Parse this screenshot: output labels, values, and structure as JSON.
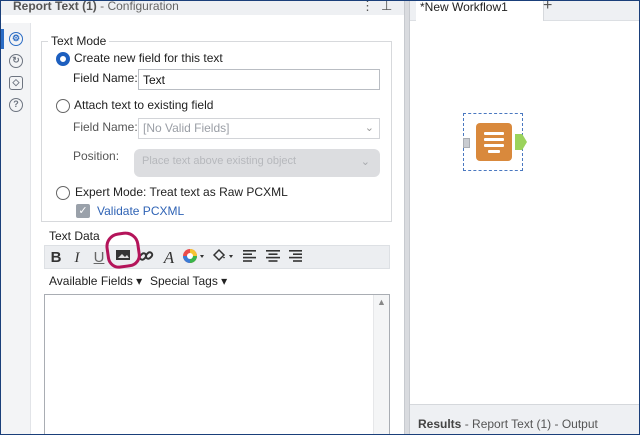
{
  "panel": {
    "title_tool": "Report Text (1)",
    "title_sep": " - ",
    "title_section": "Configuration",
    "menu_icon": "more-vertical-icon",
    "pin_icon": "pin-icon"
  },
  "side_rail": [
    {
      "icon": "gear-icon",
      "glyph": "⚙",
      "active": true
    },
    {
      "icon": "connections-icon",
      "glyph": "⟲",
      "active": false
    },
    {
      "icon": "tag-icon",
      "glyph": "◇",
      "active": false
    },
    {
      "icon": "help-icon",
      "glyph": "?",
      "active": false
    }
  ],
  "text_mode": {
    "legend": "Text Mode",
    "option_create": "Create new field for this text",
    "field_name_label": "Field Name:",
    "field_name_value": "Text",
    "option_attach": "Attach text to existing field",
    "attach_field_label": "Field Name:",
    "attach_field_value": "[No Valid Fields]",
    "position_label": "Position:",
    "position_value": "Place text above existing object",
    "option_expert": "Expert Mode: Treat text as Raw PCXML",
    "validate_label": "Validate PCXML",
    "selected_option": "create"
  },
  "text_data": {
    "legend": "Text Data",
    "toolbar": [
      {
        "name": "bold-button",
        "glyph": "B"
      },
      {
        "name": "italic-button",
        "glyph": "I"
      },
      {
        "name": "underline-button",
        "glyph": "U"
      },
      {
        "name": "insert-image-button",
        "glyph": "▬"
      },
      {
        "name": "insert-link-button",
        "glyph": "🔗"
      },
      {
        "name": "font-button",
        "glyph": "A"
      },
      {
        "name": "text-color-button",
        "glyph": "●"
      },
      {
        "name": "fill-color-button",
        "glyph": "◈"
      },
      {
        "name": "align-left-button",
        "glyph": "≡"
      },
      {
        "name": "align-center-button",
        "glyph": "≡"
      },
      {
        "name": "align-right-button",
        "glyph": "≡"
      }
    ],
    "available_fields_label": "Available Fields",
    "special_tags_label": "Special Tags",
    "dropdown_caret": "▾",
    "editor_value": ""
  },
  "canvas": {
    "tab_label": "*New Workflow1",
    "add_tab_glyph": "+",
    "tool_name": "report-text-tool"
  },
  "results": {
    "label": "Results",
    "sep": " - ",
    "detail": "Report Text (1) - Output"
  },
  "colors": {
    "accent": "#1d5fbf",
    "tool_orange": "#d9893c",
    "anchor_green": "#9bd35c",
    "highlight": "#b4145a"
  }
}
